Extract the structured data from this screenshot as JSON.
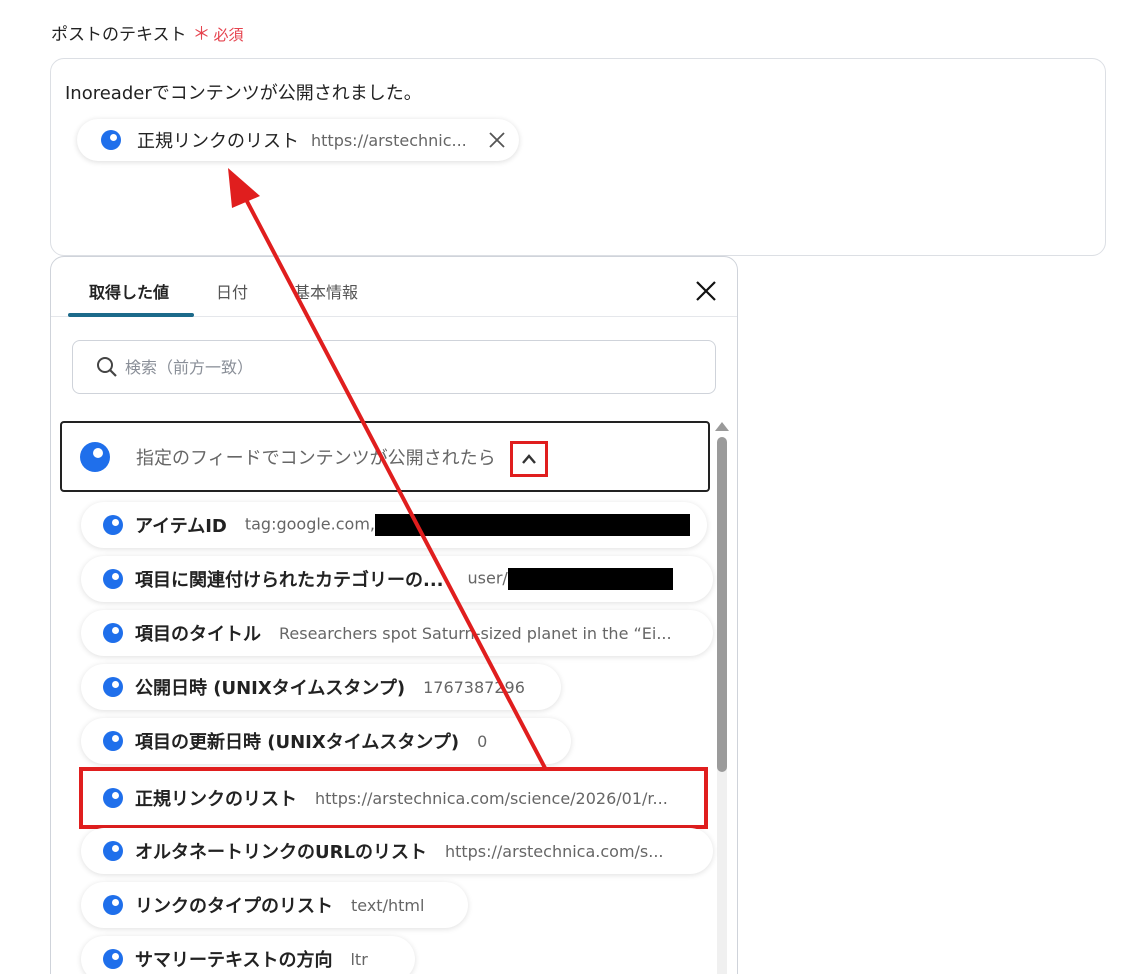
{
  "field": {
    "label": "ポストのテキスト",
    "required_mark": "＊",
    "required_text": "必須"
  },
  "editor": {
    "text": "Inoreaderでコンテンツが公開されました。",
    "chip": {
      "label": "正規リンクのリスト",
      "value": "https://arstechnic..."
    }
  },
  "panel": {
    "tabs": [
      {
        "label": "取得した値",
        "active": true
      },
      {
        "label": "日付",
        "active": false
      },
      {
        "label": "基本情報",
        "active": false
      }
    ],
    "search": {
      "placeholder": "検索（前方一致）",
      "value": ""
    },
    "group": {
      "label": "指定のフィードでコンテンツが公開されたら"
    },
    "items": [
      {
        "label": "アイテムID",
        "value": "tag:google.com,",
        "redacted": true
      },
      {
        "label": "項目に関連付けられたカテゴリーの...",
        "value": "user/",
        "redacted": true
      },
      {
        "label": "項目のタイトル",
        "value": "Researchers spot Saturn-sized planet in the “Ei..."
      },
      {
        "label": "公開日時 (UNIXタイムスタンプ)",
        "value": "1767387296"
      },
      {
        "label": "項目の更新日時 (UNIXタイムスタンプ)",
        "value": "0"
      },
      {
        "label": "正規リンクのリスト",
        "value": "https://arstechnica.com/science/2026/01/r...",
        "highlighted": true
      },
      {
        "label": "オルタネートリンクのURLのリスト",
        "value": "https://arstechnica.com/s..."
      },
      {
        "label": "リンクのタイプのリスト",
        "value": "text/html"
      },
      {
        "label": "サマリーテキストの方向",
        "value": "ltr"
      }
    ]
  },
  "colors": {
    "accent_blue": "#1f6feb",
    "highlight_red": "#e01e1e",
    "required_red": "#e5424d",
    "tab_indicator": "#1c6a8a"
  }
}
